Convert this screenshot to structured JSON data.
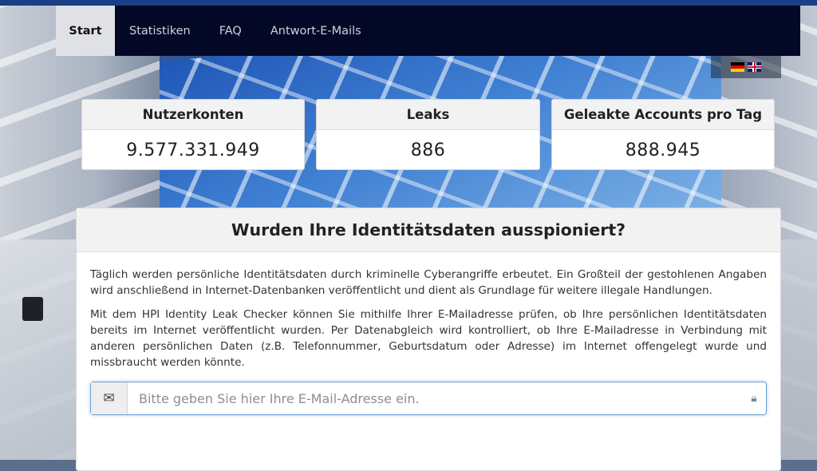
{
  "nav": {
    "items": [
      {
        "label": "Start",
        "active": true
      },
      {
        "label": "Statistiken",
        "active": false
      },
      {
        "label": "FAQ",
        "active": false
      },
      {
        "label": "Antwort-E-Mails",
        "active": false
      }
    ]
  },
  "languages": [
    {
      "icon": "german-flag-icon"
    },
    {
      "icon": "uk-flag-icon"
    }
  ],
  "stats": [
    {
      "title": "Nutzerkonten",
      "value": "9.577.331.949"
    },
    {
      "title": "Leaks",
      "value": "886"
    },
    {
      "title": "Geleakte Accounts pro Tag",
      "value": "888.945"
    }
  ],
  "panel": {
    "title": "Wurden Ihre Identitätsdaten ausspioniert?",
    "paragraph1": "Täglich werden persönliche Identitätsdaten durch kriminelle Cyberangriffe erbeutet. Ein Großteil der gestohlenen Angaben wird anschließend in Internet-Datenbanken veröffentlicht und dient als Grundlage für weitere illegale Handlungen.",
    "paragraph2": "Mit dem HPI Identity Leak Checker können Sie mithilfe Ihrer E-Mailadresse prüfen, ob Ihre persönlichen Identitätsdaten bereits im Internet veröffentlicht wurden. Per Datenabgleich wird kontrolliert, ob Ihre E-Mailadresse in Verbindung mit anderen persönlichen Daten (z.B. Telefonnummer, Geburtsdatum oder Adresse) im Internet offengelegt wurde und missbraucht werden könnte.",
    "search": {
      "placeholder": "Bitte geben Sie hier Ihre E-Mail-Adresse ein.",
      "value": "",
      "icon": "envelope-icon",
      "lock_icon": "lock-icon"
    }
  },
  "background": {
    "nav_bg": "#030826",
    "accent": "#1a3f86"
  }
}
